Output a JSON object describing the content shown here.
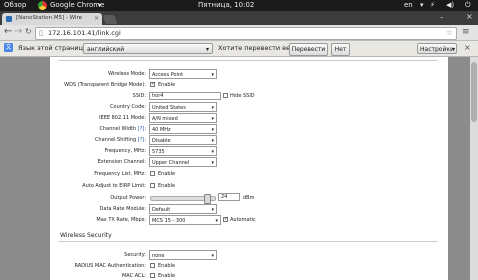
{
  "panel": {
    "overview": "Обзор",
    "app": "Google Chrome",
    "clock": "Пятница, 10:02",
    "lang": "en"
  },
  "tab": {
    "title": "[NanoStation M5] - Wire"
  },
  "url": "172.16.101.41/link.cgi",
  "translate": {
    "page_lang_label": "Язык этой страницы",
    "page_lang_value": "английский",
    "question": "Хотите перевести ее?",
    "translate_btn": "Перевести",
    "no_btn": "Нет",
    "settings_btn": "Настройки"
  },
  "form": {
    "wireless_mode": {
      "label": "Wireless Mode:",
      "value": "Access Point"
    },
    "wds": {
      "label": "WDS (Transparent Bridge Mode):",
      "check": "Enable"
    },
    "ssid": {
      "label": "SSID:",
      "value": "hor4",
      "hide": "Hide SSID"
    },
    "country": {
      "label": "Country Code:",
      "value": "United States"
    },
    "ieee": {
      "label": "IEEE 802.11 Mode:",
      "value": "A/N mixed"
    },
    "width": {
      "label": "Channel Width",
      "help": "[?]",
      "value": "40 MHz"
    },
    "shifting": {
      "label": "Channel Shifting",
      "help": "[?]",
      "value": "Disable"
    },
    "freq": {
      "label": "Frequency, MHz:",
      "value": "5735"
    },
    "ext": {
      "label": "Extension Channel:",
      "value": "Upper Channel"
    },
    "freqlist": {
      "label": "Frequency List, MHz:",
      "check": "Enable"
    },
    "eirp": {
      "label": "Auto Adjust to EIRP Limit:",
      "check": "Enable"
    },
    "power": {
      "label": "Output Power:",
      "value": "24",
      "unit": "dBm",
      "level": 0.9
    },
    "rate_module": {
      "label": "Data Rate Module:",
      "value": "Default"
    },
    "max_rate": {
      "label": "Max TX Rate, Mbps:",
      "value": "MCS 15 - 300",
      "auto": "Automatic"
    },
    "sec_title": "Wireless Security",
    "security": {
      "label": "Security:",
      "value": "none"
    },
    "radius": {
      "label": "RADIUS MAC Authentication:",
      "check": "Enable"
    },
    "macacl": {
      "label": "MAC ACL:",
      "check": "Enable"
    }
  }
}
